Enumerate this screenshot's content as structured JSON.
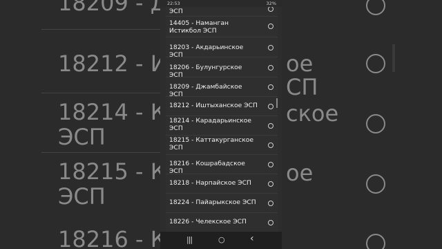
{
  "background": {
    "left_texts": [
      "18209 - Д",
      "18212 - И",
      "18214 - К",
      "ЭСП",
      "18215 - К",
      "ЭСП",
      "18216 - К"
    ],
    "right_texts": [
      "ое",
      "СП",
      "ское",
      "ое"
    ]
  },
  "statusbar": {
    "time": "22:53",
    "right_text": "32%"
  },
  "list": {
    "items": [
      {
        "label": "ЭСП"
      },
      {
        "label": "14405 - Наманган Истикбол ЭСП"
      },
      {
        "label": "18203 - Акдарьинское ЭСП"
      },
      {
        "label": "18206 - Булунгурское ЭСП"
      },
      {
        "label": "18209 - Джамбайское ЭСП"
      },
      {
        "label": "18212 - Иштыханское ЭСП"
      },
      {
        "label": "18214 - Карадарьинское ЭСП"
      },
      {
        "label": "18215 - Каттакурганское ЭСП"
      },
      {
        "label": "18216 - Кошрабадское ЭСП"
      },
      {
        "label": "18218 - Нарпайское ЭСП"
      },
      {
        "label": "18224 - Пайарыкское ЭСП"
      },
      {
        "label": "18226 - Челекское ЭСП"
      }
    ]
  },
  "navbar": {
    "recent_icon": "recent-apps-icon",
    "home_icon": "home-icon",
    "back_icon": "back-icon",
    "recent_glyph": "|||",
    "home_glyph": "○",
    "back_glyph": "‹"
  }
}
